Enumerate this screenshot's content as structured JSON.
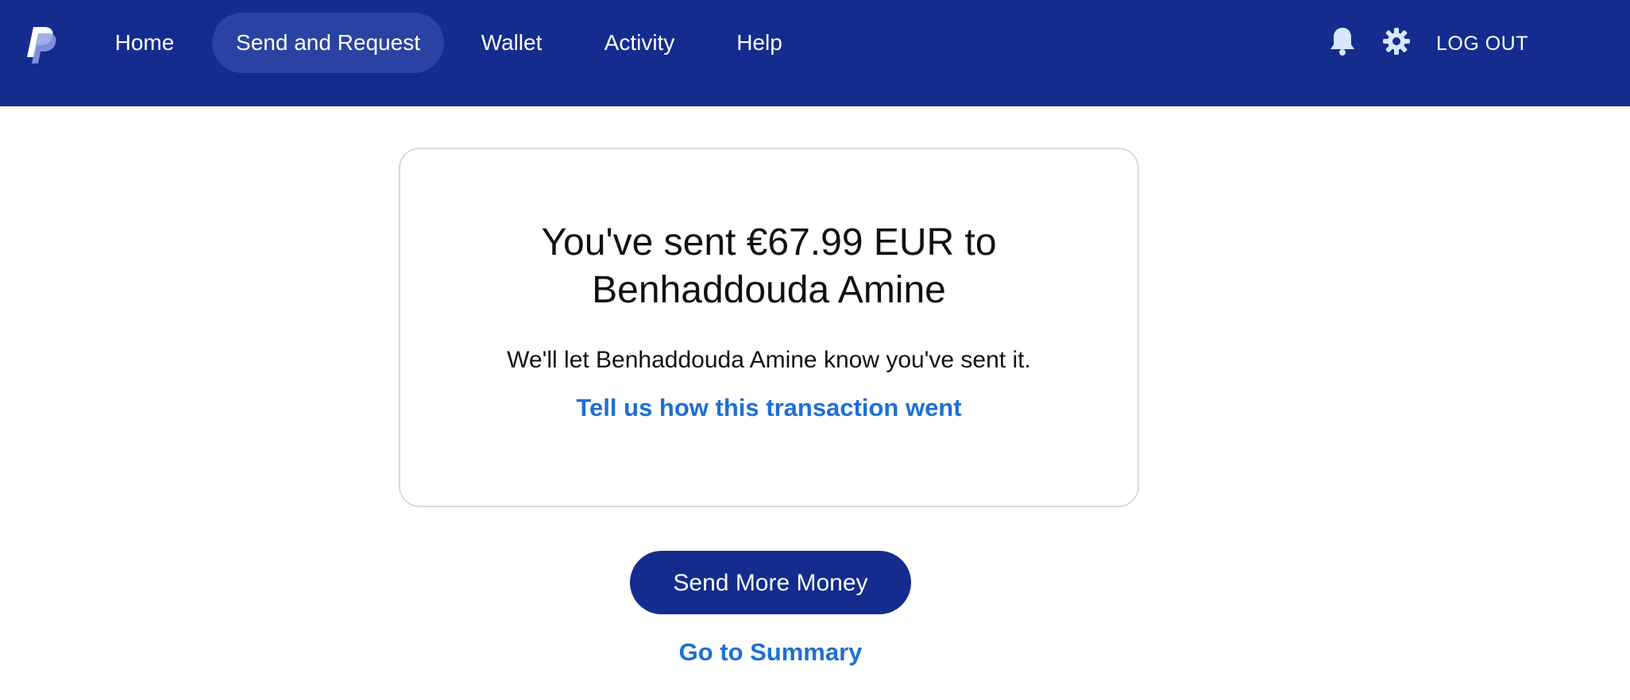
{
  "brand": {
    "logo_icon": "paypal-logo",
    "primary_color": "#142c8e",
    "link_color": "#1c6fd6"
  },
  "nav": {
    "items": [
      {
        "label": "Home",
        "active": false
      },
      {
        "label": "Send and Request",
        "active": true
      },
      {
        "label": "Wallet",
        "active": false
      },
      {
        "label": "Activity",
        "active": false
      },
      {
        "label": "Help",
        "active": false
      }
    ],
    "notifications_icon": "bell-icon",
    "settings_icon": "gear-icon",
    "logout_label": "LOG OUT"
  },
  "confirmation": {
    "title_line1": "You've sent €67.99 EUR to",
    "title_line2": "Benhaddouda Amine",
    "subtitle": "We'll let Benhaddouda Amine know you've sent it.",
    "feedback_link": "Tell us how this transaction went"
  },
  "actions": {
    "send_more_label": "Send More Money",
    "summary_label": "Go to Summary"
  }
}
